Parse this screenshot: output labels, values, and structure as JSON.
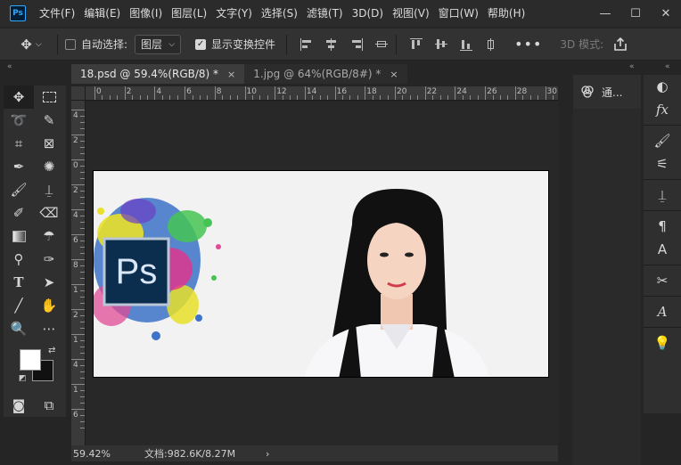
{
  "app": {
    "logo_text": "Ps"
  },
  "menu": [
    "文件(F)",
    "编辑(E)",
    "图像(I)",
    "图层(L)",
    "文字(Y)",
    "选择(S)",
    "滤镜(T)",
    "3D(D)",
    "视图(V)",
    "窗口(W)",
    "帮助(H)"
  ],
  "window_controls": {
    "minimize": "—",
    "maximize": "☐",
    "close": "✕"
  },
  "options": {
    "auto_select_label": "自动选择:",
    "auto_select_checked": false,
    "layer_select_value": "图层",
    "show_transform_label": "显示变换控件",
    "show_transform_checked": true,
    "mode3d_label": "3D 模式:",
    "more": "•••"
  },
  "tabs": [
    {
      "label": "18.psd @ 59.4%(RGB/8) *",
      "close": "×",
      "active": true
    },
    {
      "label": "1.jpg @ 64%(RGB/8#) *",
      "close": "×",
      "active": false
    }
  ],
  "ruler_h": [
    "0",
    "2",
    "4",
    "6",
    "8",
    "10",
    "12",
    "14",
    "16",
    "18",
    "20",
    "22",
    "24",
    "26",
    "28",
    "30"
  ],
  "ruler_v": [
    "4",
    "2",
    "0",
    "2",
    "4",
    "6",
    "8",
    "1",
    "2",
    "1",
    "4",
    "1",
    "6"
  ],
  "status": {
    "zoom": "59.42%",
    "docinfo": "文档:982.6K/8.27M",
    "arrow": "›"
  },
  "panel": {
    "channels_label": "通..."
  },
  "collapse": {
    "left": "«",
    "mid": "«",
    "right": "«"
  },
  "colors": {
    "foreground": "#ffffff",
    "background": "#111111",
    "accent": "#31a8ff"
  },
  "canvas_image": {
    "logo_text": "Ps"
  }
}
